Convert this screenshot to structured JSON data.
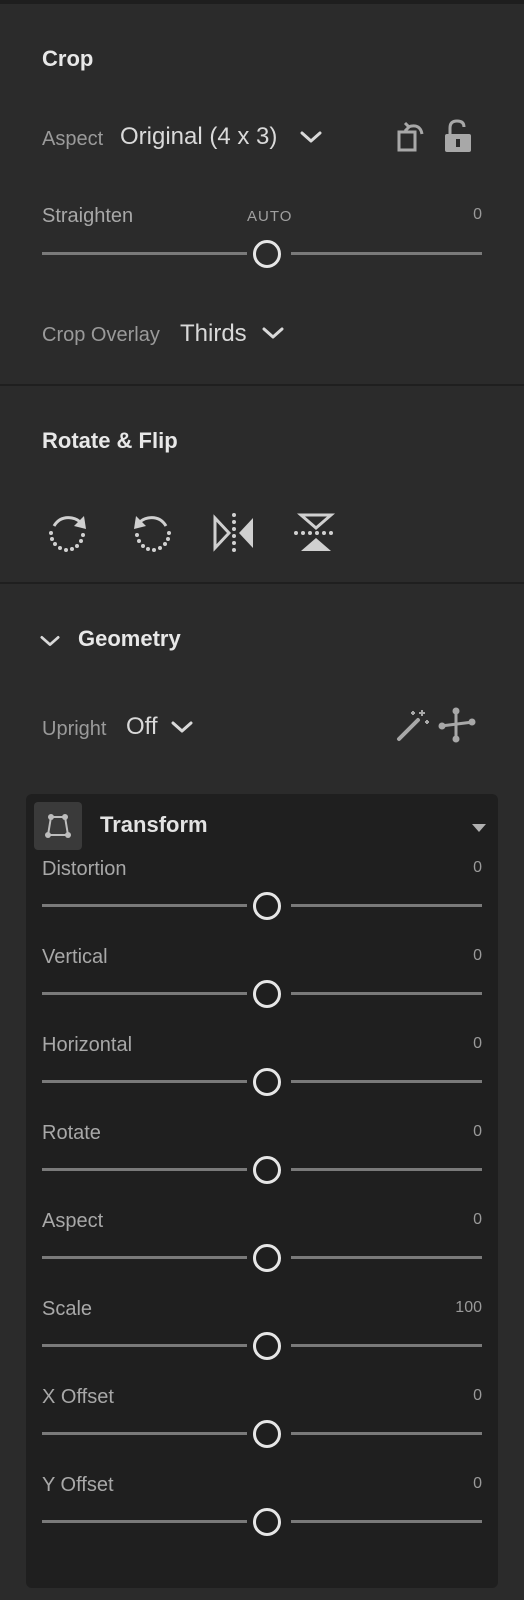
{
  "crop": {
    "title": "Crop",
    "aspect_label": "Aspect",
    "aspect_value": "Original (4 x 3)",
    "straighten": {
      "label": "Straighten",
      "auto": "AUTO",
      "value": "0"
    },
    "overlay_label": "Crop Overlay",
    "overlay_value": "Thirds"
  },
  "rotate_flip": {
    "title": "Rotate & Flip"
  },
  "geometry": {
    "title": "Geometry",
    "upright_label": "Upright",
    "upright_value": "Off"
  },
  "transform": {
    "title": "Transform",
    "sliders": [
      {
        "label": "Distortion",
        "value": "0"
      },
      {
        "label": "Vertical",
        "value": "0"
      },
      {
        "label": "Horizontal",
        "value": "0"
      },
      {
        "label": "Rotate",
        "value": "0"
      },
      {
        "label": "Aspect",
        "value": "0"
      },
      {
        "label": "Scale",
        "value": "100"
      },
      {
        "label": "X Offset",
        "value": "0"
      },
      {
        "label": "Y Offset",
        "value": "0"
      }
    ]
  },
  "colors": {
    "background": "#2b2b2b",
    "panel": "#1f1f1f",
    "thumb": "#e6e6e6",
    "track": "#7a7a7a"
  },
  "icons": [
    "rotate-lock-icon",
    "lock-open-icon",
    "rotate-clockwise-icon",
    "rotate-counterclockwise-icon",
    "flip-horizontal-icon",
    "flip-vertical-icon",
    "chevron-down-icon",
    "magic-wand-icon",
    "guided-upright-icon",
    "transform-icon"
  ]
}
